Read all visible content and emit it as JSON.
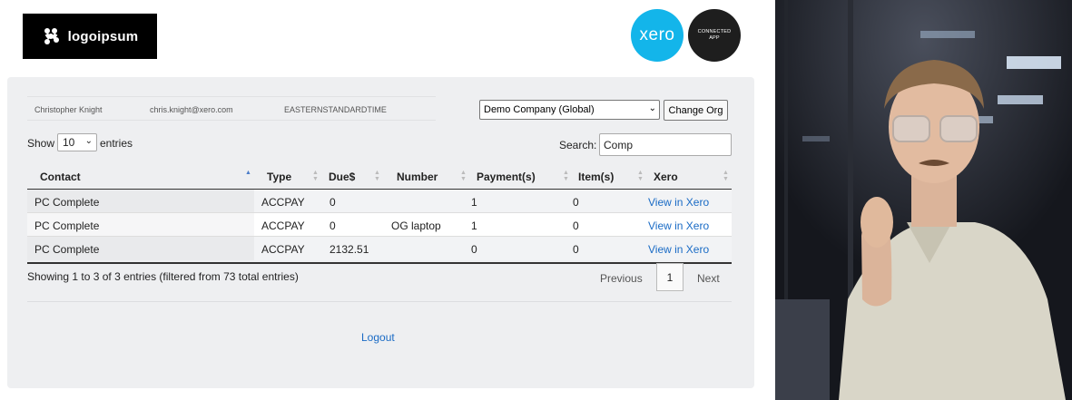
{
  "header": {
    "logo_text": "logoipsum",
    "xero_badge": "xero",
    "connected_line1": "CONNECTED",
    "connected_line2": "APP"
  },
  "user": {
    "name": "Christopher Knight",
    "email": "chris.knight@xero.com",
    "timezone": "EASTERNSTANDARDTIME"
  },
  "org": {
    "selected": "Demo Company (Global)",
    "change_label": "Change Org"
  },
  "controls": {
    "show_label": "Show",
    "page_size": "10",
    "entries_label": "entries",
    "search_label": "Search:",
    "search_value": "Comp"
  },
  "table": {
    "columns": [
      "Contact",
      "Type",
      "Due$",
      "Number",
      "Payment(s)",
      "Item(s)",
      "Xero"
    ],
    "rows": [
      {
        "contact": "PC Complete",
        "type": "ACCPAY",
        "due": "0",
        "number": "",
        "payments": "1",
        "items": "0",
        "xero": "View in Xero"
      },
      {
        "contact": "PC Complete",
        "type": "ACCPAY",
        "due": "0",
        "number": "OG laptop",
        "payments": "1",
        "items": "0",
        "xero": "View in Xero"
      },
      {
        "contact": "PC Complete",
        "type": "ACCPAY",
        "due": "2132.51",
        "number": "",
        "payments": "0",
        "items": "0",
        "xero": "View in Xero"
      }
    ]
  },
  "footer": {
    "info": "Showing 1 to 3 of 3 entries (filtered from 73 total entries)",
    "previous": "Previous",
    "page": "1",
    "next": "Next",
    "logout": "Logout"
  },
  "colors": {
    "xero_blue": "#13b5ea",
    "link_blue": "#1a6bc5",
    "panel_bg": "#eeeff1"
  },
  "icons": {
    "logo_mark": "logo-mark-icon",
    "sort": "sort-arrows-icon",
    "dropdown": "chevron-down-icon"
  }
}
